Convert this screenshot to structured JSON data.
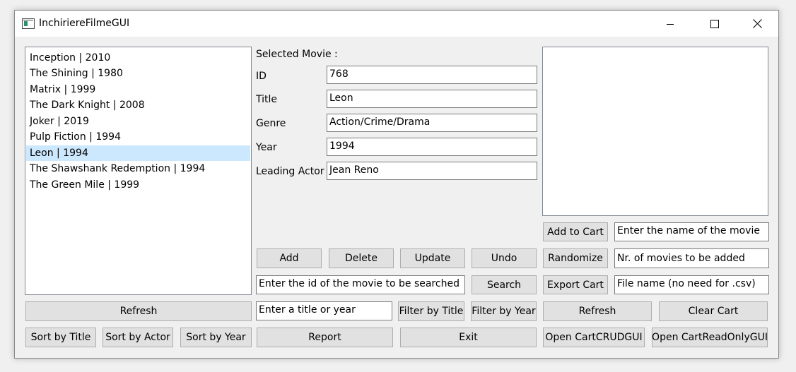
{
  "window": {
    "title": "InchiriereFilmeGUI"
  },
  "movie_list": {
    "items": [
      {
        "label": "Inception | 2010",
        "selected": false
      },
      {
        "label": "The Shining | 1980",
        "selected": false
      },
      {
        "label": "Matrix | 1999",
        "selected": false
      },
      {
        "label": "The Dark Knight | 2008",
        "selected": false
      },
      {
        "label": "Joker | 2019",
        "selected": false
      },
      {
        "label": "Pulp Fiction | 1994",
        "selected": false
      },
      {
        "label": "Leon | 1994",
        "selected": true
      },
      {
        "label": "The Shawshank Redemption | 1994",
        "selected": false
      },
      {
        "label": "The Green Mile | 1999",
        "selected": false
      }
    ],
    "selected_color": "#cce8ff"
  },
  "details": {
    "header": "Selected Movie :",
    "id_label": "ID",
    "id_value": "768",
    "title_label": "Title",
    "title_value": "Leon",
    "genre_label": "Genre",
    "genre_value": "Action/Crime/Drama",
    "year_label": "Year",
    "year_value": "1994",
    "actor_label": "Leading Actor",
    "actor_value": "Jean Reno"
  },
  "crud": {
    "add": "Add",
    "delete": "Delete",
    "update": "Update",
    "undo": "Undo"
  },
  "search": {
    "id_field": "Enter the id of the movie to be searched",
    "search_button": "Search",
    "filter_field": "Enter a title or year",
    "filter_title": "Filter by Title",
    "filter_year": "Filter by Year"
  },
  "left_actions": {
    "refresh": "Refresh",
    "sort_title": "Sort by Title",
    "sort_actor": "Sort by Actor",
    "sort_year": "Sort by Year"
  },
  "bottom": {
    "report": "Report",
    "exit": "Exit"
  },
  "cart": {
    "add_to_cart": "Add to Cart",
    "movie_name_field": "Enter the name of the movie",
    "randomize": "Randomize",
    "count_field": "Nr. of movies to be added",
    "export": "Export Cart",
    "file_field": "File name (no need for .csv)",
    "refresh": "Refresh",
    "clear": "Clear Cart",
    "open_crud": "Open CartCRUDGUI",
    "open_readonly": "Open CartReadOnlyGUI"
  }
}
